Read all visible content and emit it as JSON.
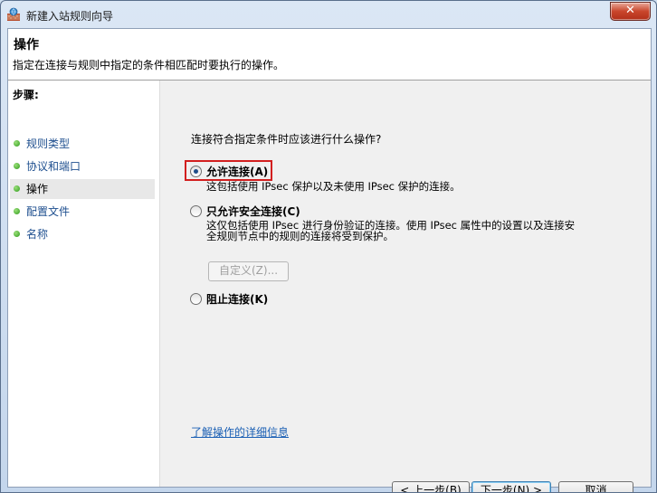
{
  "window": {
    "title": "新建入站规则向导",
    "close_label": "✕"
  },
  "header": {
    "title": "操作",
    "description": "指定在连接与规则中指定的条件相匹配时要执行的操作。"
  },
  "steps": {
    "label": "步骤:",
    "items": [
      {
        "label": "规则类型"
      },
      {
        "label": "协议和端口"
      },
      {
        "label": "操作",
        "active": true
      },
      {
        "label": "配置文件"
      },
      {
        "label": "名称"
      }
    ]
  },
  "content": {
    "question": "连接符合指定条件时应该进行什么操作?",
    "options": [
      {
        "label": "允许连接(A)",
        "description": "这包括使用 IPsec 保护以及未使用 IPsec 保护的连接。",
        "selected": true
      },
      {
        "label": "只允许安全连接(C)",
        "description_line1": "这仅包括使用 IPsec 进行身份验证的连接。使用 IPsec 属性中的设置以及连接安",
        "description_line2": "全规则节点中的规则的连接将受到保护。",
        "selected": false
      },
      {
        "label": "阻止连接(K)",
        "selected": false
      }
    ],
    "customize_button": "自定义(Z)...",
    "learn_more_link": "了解操作的详细信息"
  },
  "buttons": {
    "back": "< 上一步(B)",
    "next": "下一步(N) >",
    "cancel": "取消"
  },
  "colors": {
    "accent": "#1a5fb4",
    "highlight": "#d21f1f"
  }
}
